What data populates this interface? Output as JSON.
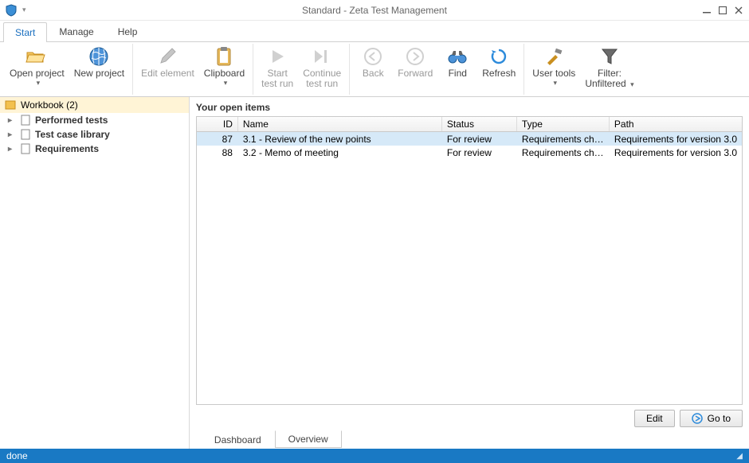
{
  "window": {
    "title": "Standard - Zeta Test Management"
  },
  "menubar": {
    "tabs": [
      {
        "label": "Start",
        "active": true
      },
      {
        "label": "Manage",
        "active": false
      },
      {
        "label": "Help",
        "active": false
      }
    ]
  },
  "ribbon": {
    "open_project": "Open project",
    "new_project": "New project",
    "edit_element": "Edit element",
    "clipboard": "Clipboard",
    "start_test_run_l1": "Start",
    "start_test_run_l2": "test run",
    "continue_test_run_l1": "Continue",
    "continue_test_run_l2": "test run",
    "back": "Back",
    "forward": "Forward",
    "find": "Find",
    "refresh": "Refresh",
    "user_tools": "User tools",
    "filter_l1": "Filter:",
    "filter_l2": "Unfiltered"
  },
  "sidebar": {
    "root": "Workbook (2)",
    "items": [
      {
        "label": "Performed tests"
      },
      {
        "label": "Test case library"
      },
      {
        "label": "Requirements"
      }
    ]
  },
  "main": {
    "section_title": "Your open items",
    "columns": {
      "id": "ID",
      "name": "Name",
      "status": "Status",
      "type": "Type",
      "path": "Path"
    },
    "rows": [
      {
        "id": "87",
        "name": "3.1 - Review of the new points",
        "status": "For review",
        "type": "Requirements chapter",
        "path": "Requirements for version 3.0",
        "selected": true
      },
      {
        "id": "88",
        "name": "3.2 - Memo of meeting",
        "status": "For review",
        "type": "Requirements chapter",
        "path": "Requirements for version 3.0",
        "selected": false
      }
    ],
    "buttons": {
      "edit": "Edit",
      "goto": "Go to"
    },
    "bottom_tabs": [
      {
        "label": "Dashboard",
        "active": false
      },
      {
        "label": "Overview",
        "active": true
      }
    ]
  },
  "statusbar": {
    "text": "done"
  }
}
